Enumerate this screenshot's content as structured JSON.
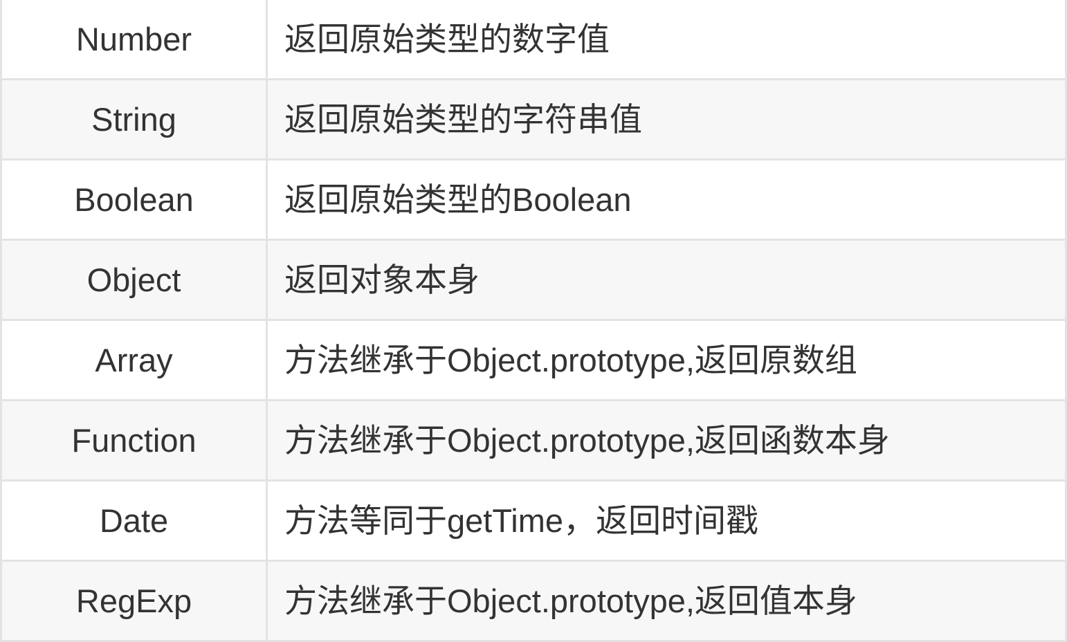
{
  "rows": [
    {
      "type": "Number",
      "description": "返回原始类型的数字值"
    },
    {
      "type": "String",
      "description": "返回原始类型的字符串值"
    },
    {
      "type": "Boolean",
      "description": "返回原始类型的Boolean"
    },
    {
      "type": "Object",
      "description": "返回对象本身"
    },
    {
      "type": "Array",
      "description": "方法继承于Object.prototype,返回原数组"
    },
    {
      "type": "Function",
      "description": "方法继承于Object.prototype,返回函数本身"
    },
    {
      "type": "Date",
      "description": "方法等同于getTime，返回时间戳"
    },
    {
      "type": "RegExp",
      "description": "方法继承于Object.prototype,返回值本身"
    }
  ],
  "colors": {
    "border": "#e3e3e3",
    "row_alt_background": "#f7f7f7",
    "text": "#333333"
  }
}
